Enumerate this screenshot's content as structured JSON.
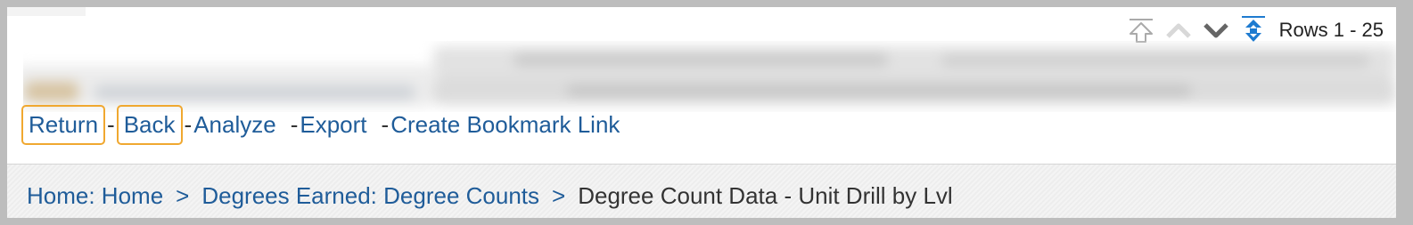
{
  "pager": {
    "rows_label": "Rows 1 - 25",
    "icons": [
      "first-page-icon",
      "previous-page-icon",
      "next-page-icon",
      "all-rows-icon"
    ]
  },
  "actions": {
    "return_label": "Return",
    "back_label": "Back",
    "analyze_label": "Analyze",
    "export_label": "Export",
    "bookmark_label": "Create Bookmark Link",
    "separator": "-"
  },
  "breadcrumb": {
    "home": "Home: Home",
    "degrees": "Degrees Earned: Degree Counts",
    "current": "Degree Count Data - Unit Drill by Lvl",
    "separator": ">"
  },
  "colors": {
    "link": "#1f5c99",
    "highlight": "#f0a830",
    "pager_accent": "#1e7bd0"
  }
}
